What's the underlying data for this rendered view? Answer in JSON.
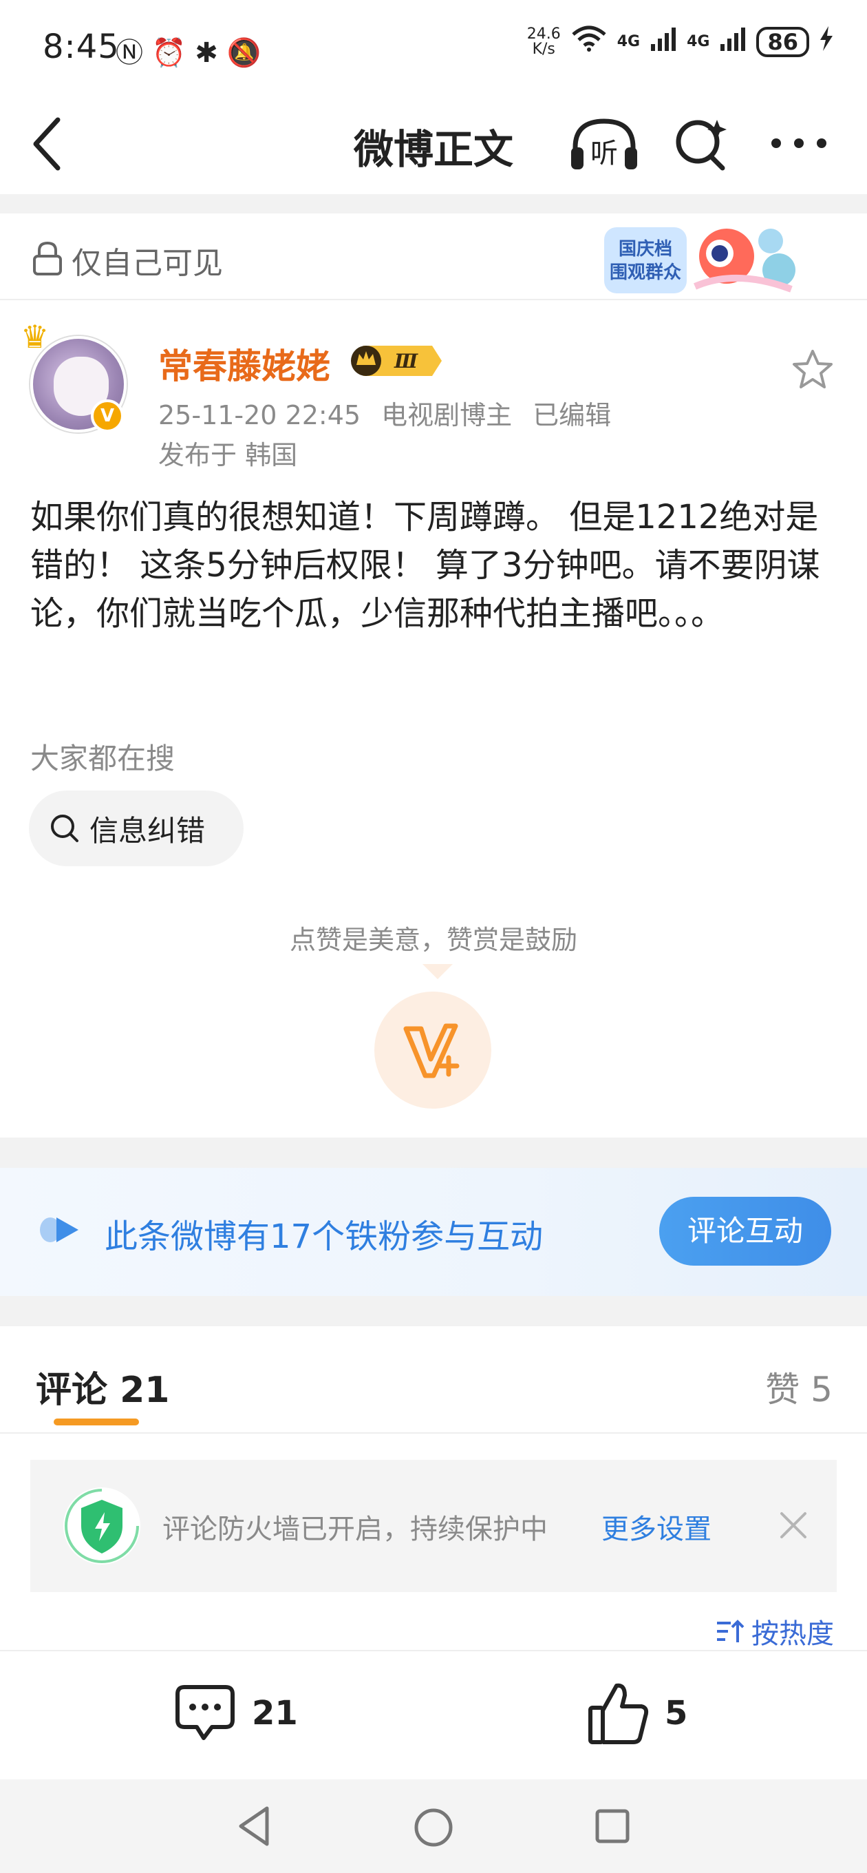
{
  "status_bar": {
    "time": "8:45",
    "net_speed_value": "24.6",
    "net_speed_unit": "K/s",
    "signal_1": "4G",
    "signal_2": "4G",
    "battery": "86"
  },
  "nav": {
    "title": "微博正文",
    "listen_label": "听"
  },
  "visibility": {
    "label": "仅自己可见",
    "badge_line1": "国庆档",
    "badge_line2": "围观群众"
  },
  "author": {
    "name": "常春藤姥姥",
    "level": "Ⅲ",
    "date": "25-11-20 22:45",
    "role": "电视剧博主",
    "edited": "已编辑",
    "location": "发布于 韩国"
  },
  "post": {
    "text": "如果你们真的很想知道！下周蹲蹲。 但是1212绝对是错的！ 这条5分钟后权限！  算了3分钟吧。请不要阴谋论，你们就当吃个瓜，少信那种代拍主播吧。。。"
  },
  "hot_search": {
    "label": "大家都在搜",
    "chip": "信息纠错"
  },
  "reward": {
    "text": "点赞是美意，赞赏是鼓励"
  },
  "fans_banner": {
    "text": "此条微博有17个铁粉参与互动",
    "button": "评论互动"
  },
  "comments_header": {
    "tab": "评论 21",
    "likes": "赞 5"
  },
  "firewall": {
    "text": "评论防火墙已开启，持续保护中",
    "more": "更多设置"
  },
  "sort": {
    "label": "按热度"
  },
  "actions": {
    "comment_count": "21",
    "like_count": "5"
  },
  "colors": {
    "username": "#e86a1a",
    "link_blue": "#2f7fe0",
    "accent_orange": "#f59a23",
    "button_blue": "#3f8ee8",
    "shield_green": "#2fbf71"
  }
}
